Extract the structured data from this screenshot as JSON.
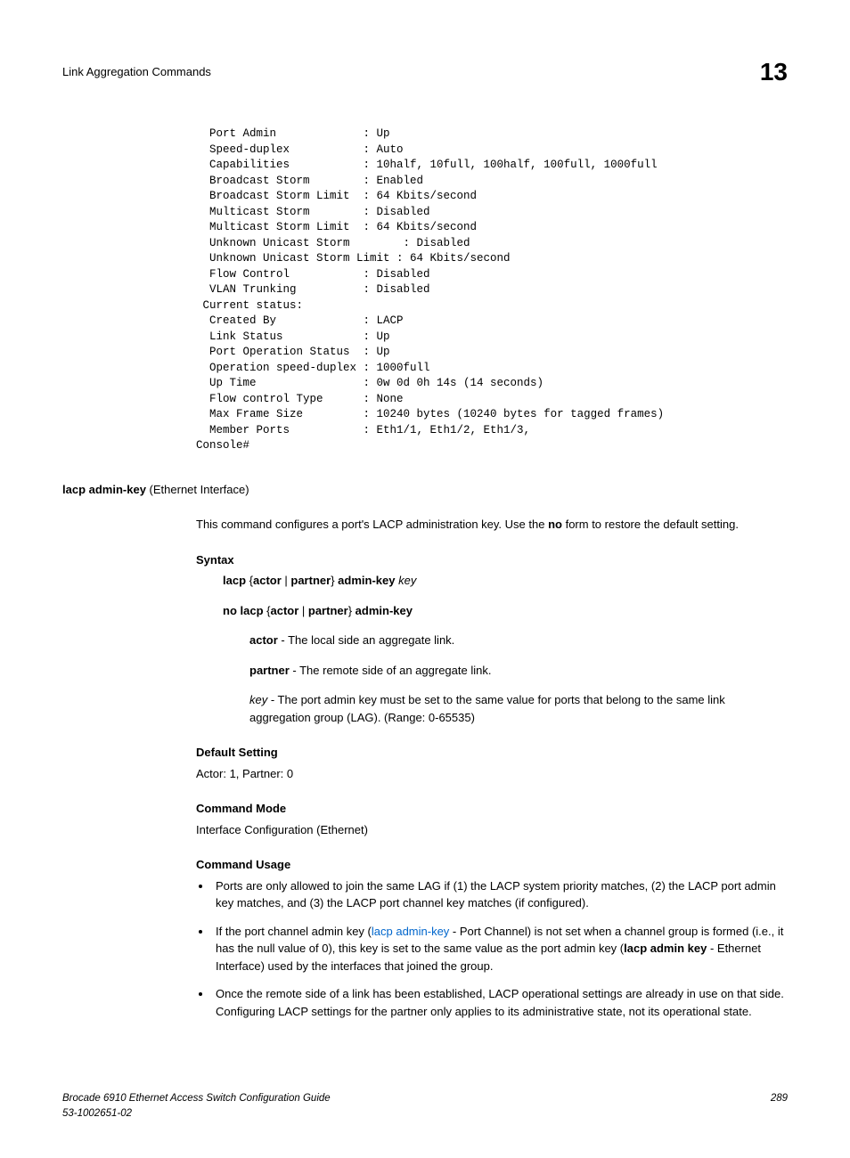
{
  "header": {
    "title": "Link Aggregation Commands",
    "chapter": "13"
  },
  "console": "  Port Admin             : Up\n  Speed-duplex           : Auto\n  Capabilities           : 10half, 10full, 100half, 100full, 1000full\n  Broadcast Storm        : Enabled\n  Broadcast Storm Limit  : 64 Kbits/second\n  Multicast Storm        : Disabled\n  Multicast Storm Limit  : 64 Kbits/second\n  Unknown Unicast Storm        : Disabled\n  Unknown Unicast Storm Limit : 64 Kbits/second\n  Flow Control           : Disabled\n  VLAN Trunking          : Disabled\n Current status:\n  Created By             : LACP\n  Link Status            : Up\n  Port Operation Status  : Up\n  Operation speed-duplex : 1000full\n  Up Time                : 0w 0d 0h 14s (14 seconds)\n  Flow control Type      : None\n  Max Frame Size         : 10240 bytes (10240 bytes for tagged frames)\n  Member Ports           : Eth1/1, Eth1/2, Eth1/3,\nConsole#",
  "command": {
    "name": "lacp admin-key",
    "context": " (Ethernet Interface)",
    "description_prefix": "This command configures a port's LACP administration key. Use the ",
    "description_bold": "no",
    "description_suffix": " form to restore the default setting."
  },
  "syntax": {
    "heading": "Syntax",
    "line1_a": "lacp",
    "line1_b": " {",
    "line1_c": "actor",
    "line1_d": " | ",
    "line1_e": "partner",
    "line1_f": "} ",
    "line1_g": "admin-key",
    "line1_h": " ",
    "line1_i": "key",
    "line2_a": "no lacp",
    "line2_b": " {",
    "line2_c": "actor",
    "line2_d": " | ",
    "line2_e": "partner",
    "line2_f": "} ",
    "line2_g": "admin-key",
    "actor_label": "actor",
    "actor_desc": " - The local side an aggregate link.",
    "partner_label": "partner",
    "partner_desc": " - The remote side of an aggregate link.",
    "key_label": "key",
    "key_desc": " - The port admin key must be set to the same value for ports that belong to the same link aggregation group (LAG). (Range: 0-65535)"
  },
  "default_setting": {
    "heading": "Default Setting",
    "text": "Actor: 1, Partner: 0"
  },
  "command_mode": {
    "heading": "Command Mode",
    "text": "Interface Configuration (Ethernet)"
  },
  "command_usage": {
    "heading": "Command Usage",
    "item1": "Ports are only allowed to join the same LAG if (1) the LACP system priority matches, (2) the LACP port admin key matches, and (3) the LACP port channel key matches (if configured).",
    "item2_a": "If the port channel admin key (",
    "item2_link": "lacp admin-key",
    "item2_b": " - Port Channel) is not set when a channel group is formed (i.e., it has the null value of 0), this key is set to the same value as the port admin key (",
    "item2_bold": "lacp admin key",
    "item2_c": " - Ethernet Interface) used by the interfaces that joined the group.",
    "item3": "Once the remote side of a link has been established, LACP operational settings are already in use on that side. Configuring LACP settings for the partner only applies to its administrative state, not its operational state."
  },
  "footer": {
    "guide": "Brocade 6910 Ethernet Access Switch Configuration Guide",
    "docnum": "53-1002651-02",
    "page": "289"
  }
}
